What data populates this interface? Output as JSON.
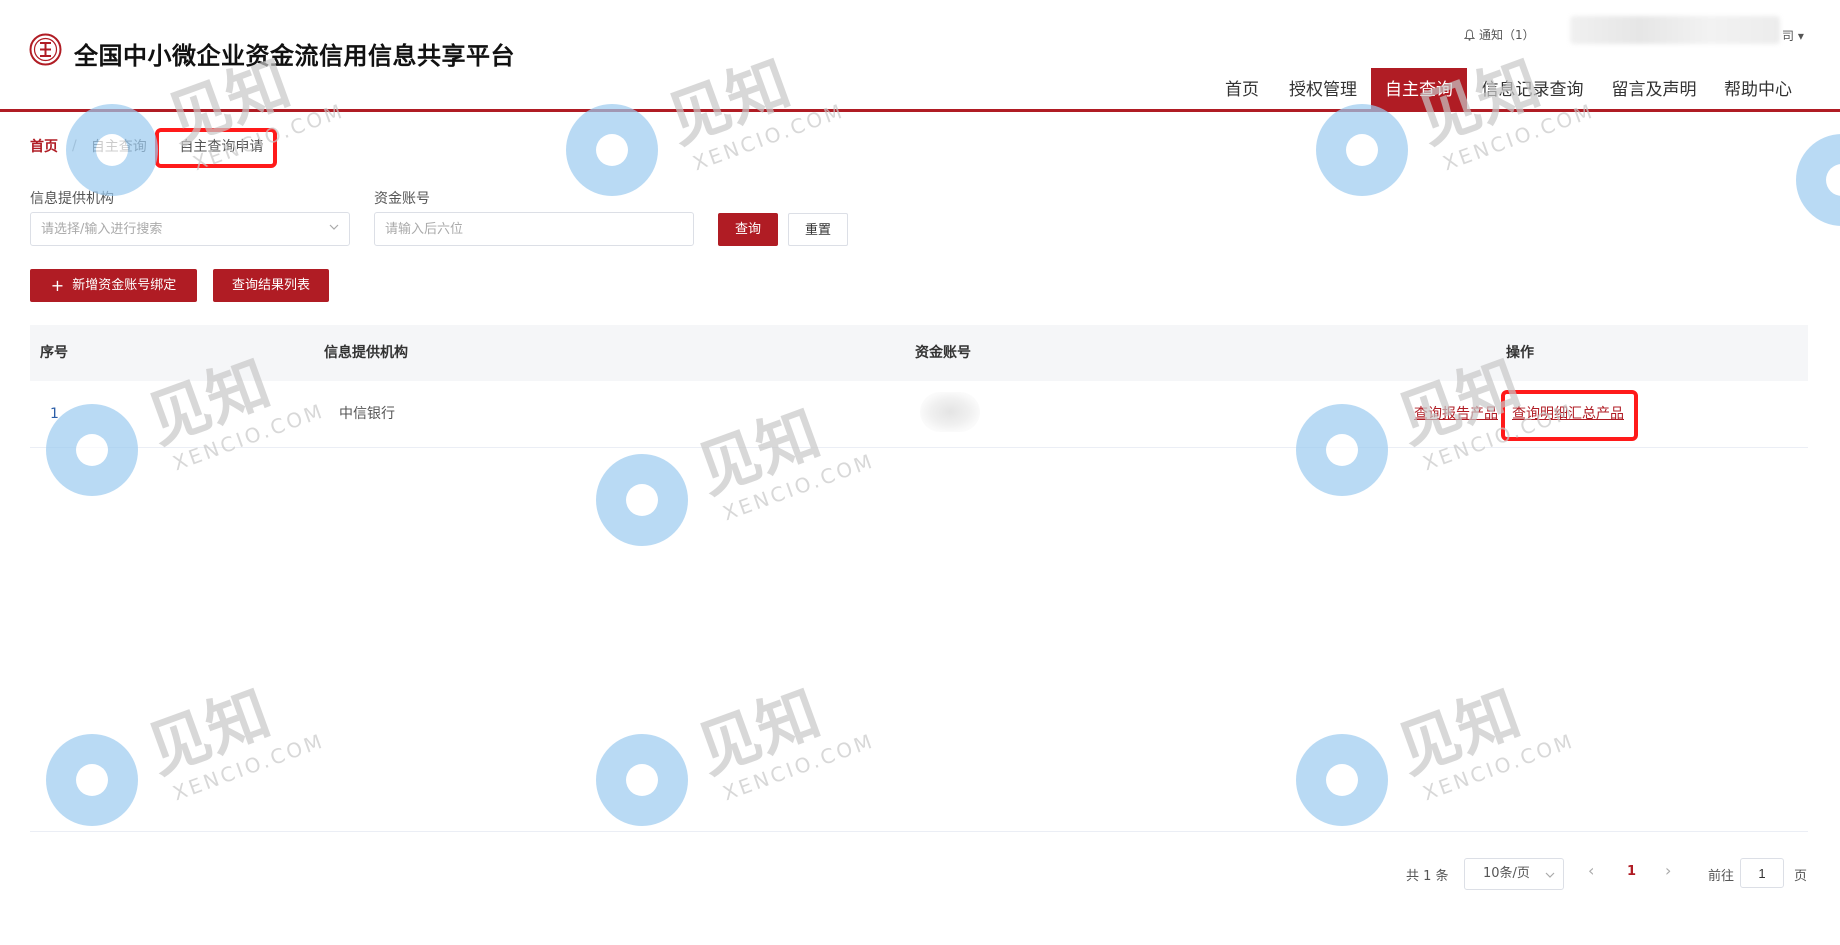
{
  "header": {
    "site_title": "全国中小微企业资金流信用信息共享平台",
    "notice": "通知（1）",
    "user_tail": "司 ▾",
    "nav": [
      {
        "label": "首页",
        "active": false
      },
      {
        "label": "授权管理",
        "active": false
      },
      {
        "label": "自主查询",
        "active": true
      },
      {
        "label": "信息记录查询",
        "active": false
      },
      {
        "label": "留言及声明",
        "active": false
      },
      {
        "label": "帮助中心",
        "active": false
      }
    ]
  },
  "breadcrumb": {
    "home": "首页",
    "separator": "/",
    "mid": "自主查询",
    "current": "自主查询申请"
  },
  "filters": {
    "provider_label": "信息提供机构",
    "provider_placeholder": "请选择/输入进行搜索",
    "account_label": "资金账号",
    "account_placeholder": "请输入后六位",
    "query_button": "查询",
    "reset_button": "重置"
  },
  "actions": {
    "add_binding": "新增资金账号绑定",
    "result_list": "查询结果列表"
  },
  "table": {
    "headers": [
      "序号",
      "信息提供机构",
      "资金账号",
      "操作"
    ],
    "rows": [
      {
        "index": "1",
        "provider": "中信银行",
        "account": "",
        "op1": "查询报告产品",
        "op2": "查询明细汇总产品"
      }
    ]
  },
  "pagination": {
    "total": "共 1 条",
    "page_size": "10条/页",
    "prev": "‹",
    "current": "1",
    "next": "›",
    "goto_label": "前往",
    "goto_value": "1",
    "goto_suffix": "页"
  },
  "watermark": {
    "brand_cn": "见知",
    "brand_en": "XENCIO.COM"
  },
  "colors": {
    "brand_red": "#b01c24",
    "highlight_red": "#ff1a1a",
    "watermark_blue": "#9ccbf0"
  }
}
